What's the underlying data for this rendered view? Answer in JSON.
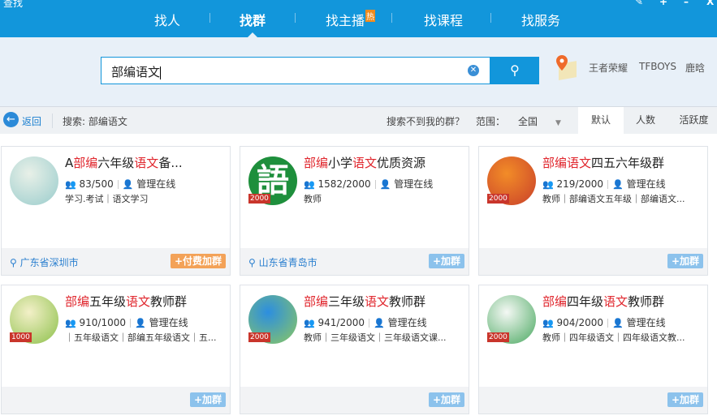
{
  "window": {
    "title": "查找",
    "controls": [
      "✎",
      "+",
      "–",
      "X"
    ]
  },
  "nav": {
    "items": [
      {
        "label": "找人"
      },
      {
        "label": "找群"
      },
      {
        "label": "找主播",
        "badge": "热"
      },
      {
        "label": "找课程"
      },
      {
        "label": "找服务"
      }
    ]
  },
  "search": {
    "value": "部编语文",
    "hot_words": [
      "王者荣耀",
      "TFBOYS",
      "鹿晗"
    ]
  },
  "toolbar": {
    "back": "返回",
    "query": "搜索: 部编语文",
    "not_found": "搜索不到我的群？",
    "range_label": "范围：",
    "range_value": "全国",
    "sort_tabs": [
      "默认",
      "人数",
      "活跃度"
    ]
  },
  "cards": [
    {
      "title": [
        [
          "A",
          0
        ],
        [
          "部编",
          1
        ],
        [
          "六年级",
          0
        ],
        [
          "语文",
          1
        ],
        [
          "备...",
          0
        ]
      ],
      "members": "83/500",
      "admin": "管理在线",
      "tags": "学习.考试｜语文学习",
      "location": "广东省深圳市",
      "join": "+付费加群",
      "paid": true,
      "badge": "",
      "avatar_colors": [
        "#e8f0e8",
        "#9cc"
      ]
    },
    {
      "title": [
        [
          "部编",
          1
        ],
        [
          "小学",
          0
        ],
        [
          "语文",
          1
        ],
        [
          "优质资源",
          0
        ]
      ],
      "members": "1582/2000",
      "admin": "管理在线",
      "tags": "教师",
      "location": "山东省青岛市",
      "join": "+加群",
      "paid": false,
      "badge": "2000",
      "avatar_glyph": "語",
      "avatar_colors": [
        "#1e8f3c",
        "#1e8f3c"
      ]
    },
    {
      "title": [
        [
          "部编语文",
          1
        ],
        [
          "四五六年级群",
          0
        ]
      ],
      "members": "219/2000",
      "admin": "管理在线",
      "tags": "教师｜部编语文五年级｜部编语文...",
      "location": "",
      "join": "+加群",
      "paid": false,
      "badge": "2000",
      "avatar_colors": [
        "#f28c28",
        "#c9402a"
      ]
    },
    {
      "title": [
        [
          "部编",
          1
        ],
        [
          "五年级",
          0
        ],
        [
          "语文",
          1
        ],
        [
          "教师群",
          0
        ]
      ],
      "members": "910/1000",
      "admin": "管理在线",
      "tags": "｜五年级语文｜部编五年级语文｜五...",
      "location": "",
      "join": "+加群",
      "paid": false,
      "badge": "1000",
      "avatar_colors": [
        "#f3f0c8",
        "#8cc04a"
      ]
    },
    {
      "title": [
        [
          "部编",
          1
        ],
        [
          "三年级",
          0
        ],
        [
          "语文",
          1
        ],
        [
          "教师群",
          0
        ]
      ],
      "members": "941/2000",
      "admin": "管理在线",
      "tags": "教师｜三年级语文｜三年级语文课...",
      "location": "",
      "join": "+加群",
      "paid": false,
      "badge": "2000",
      "avatar_colors": [
        "#2c8ee0",
        "#8cc860"
      ]
    },
    {
      "title": [
        [
          "部编",
          1
        ],
        [
          "四年级",
          0
        ],
        [
          "语文",
          1
        ],
        [
          "教师群",
          0
        ]
      ],
      "members": "904/2000",
      "admin": "管理在线",
      "tags": "教师｜四年级语文｜四年级语文教...",
      "location": "",
      "join": "+加群",
      "paid": false,
      "badge": "2000",
      "avatar_colors": [
        "#f4f8f4",
        "#4aa860"
      ]
    }
  ]
}
